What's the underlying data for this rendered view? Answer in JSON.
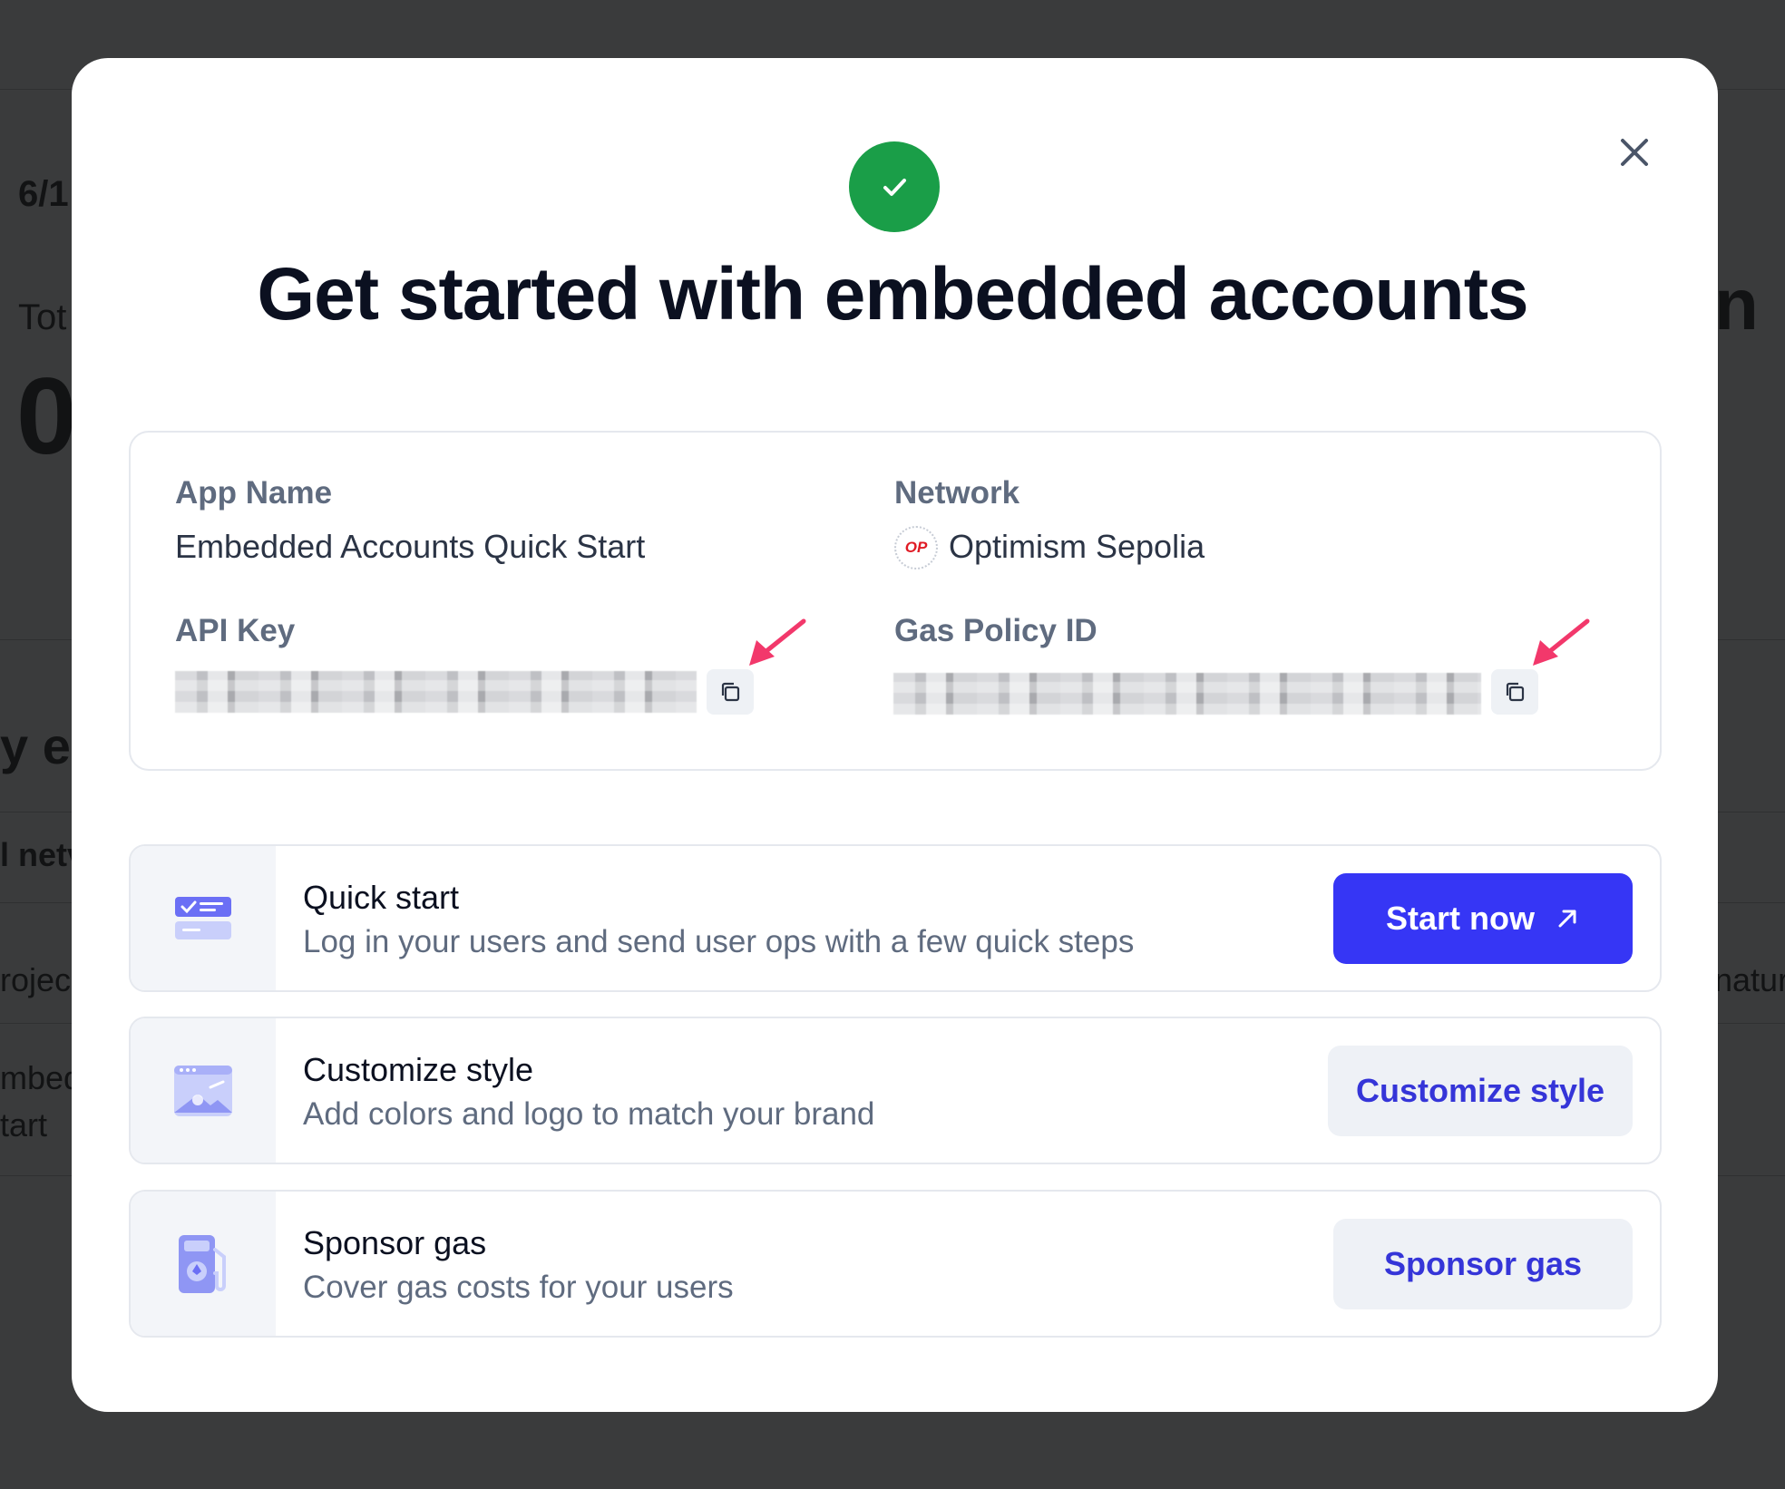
{
  "background": {
    "fragments": [
      "6/1",
      "Tot",
      "0",
      "y er",
      "l netv",
      "rojec",
      "mbed",
      "tart",
      "n",
      "natur"
    ]
  },
  "modal": {
    "title": "Get started with embedded accounts",
    "close_icon": "close-icon",
    "success_icon": "check-icon",
    "info": {
      "app_name_label": "App Name",
      "app_name_value": "Embedded Accounts Quick Start",
      "network_label": "Network",
      "network_value": "Optimism Sepolia",
      "network_logo_text": "OP",
      "api_key_label": "API Key",
      "gas_policy_label": "Gas Policy ID"
    },
    "actions": [
      {
        "title": "Quick start",
        "description": "Log in your users and send user ops with a few quick steps",
        "button": "Start now",
        "icon": "quickstart-icon"
      },
      {
        "title": "Customize style",
        "description": "Add colors and logo to match your brand",
        "button": "Customize style",
        "icon": "palette-window-icon"
      },
      {
        "title": "Sponsor gas",
        "description": "Cover gas costs for your users",
        "button": "Sponsor gas",
        "icon": "gas-pump-icon"
      }
    ]
  },
  "colors": {
    "primary": "#3636f5",
    "success": "#1a9e48",
    "annotation_arrow": "#f2386b"
  }
}
